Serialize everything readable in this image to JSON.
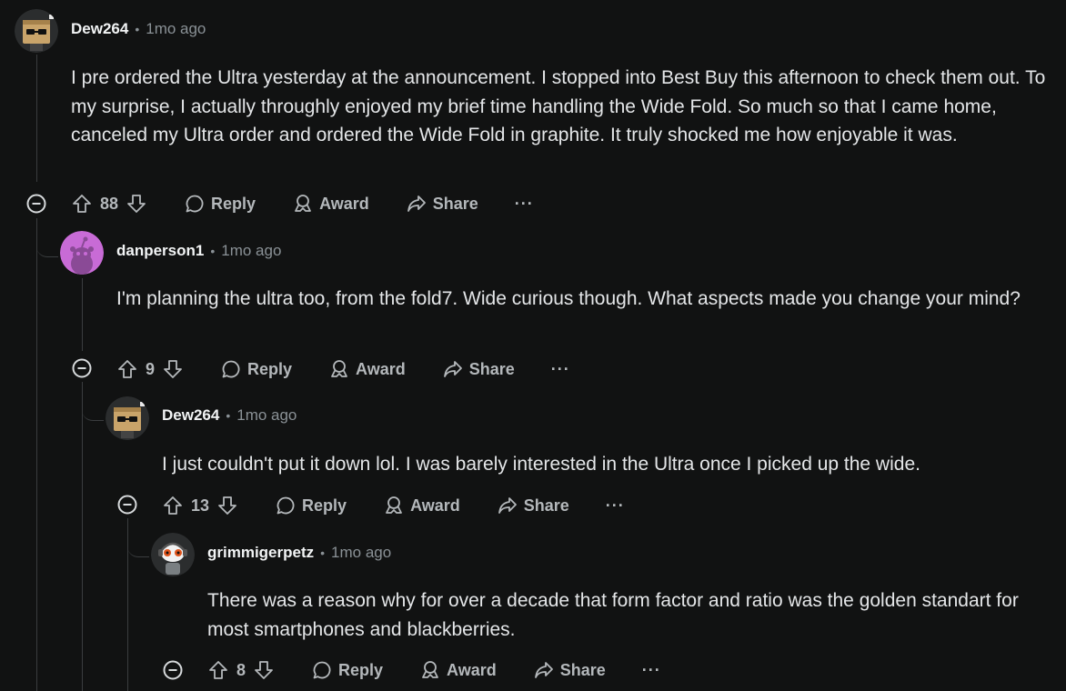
{
  "comments": [
    {
      "username": "Dew264",
      "time": "1mo ago",
      "body": "I pre ordered the Ultra yesterday at the announcement. I stopped into Best Buy this afternoon to check them out. To my surprise, I actually throughly enjoyed my brief time handling the Wide Fold. So much so that I came home, canceled my Ultra order and ordered the Wide Fold in graphite. It truly shocked me how enjoyable it was.",
      "score": "88",
      "avatar_icon": "box-character-avatar"
    },
    {
      "username": "danperson1",
      "time": "1mo ago",
      "body": "I'm planning the ultra too, from the fold7. Wide curious though. What aspects made you change your mind?",
      "score": "9",
      "avatar_icon": "snoo-avatar"
    },
    {
      "username": "Dew264",
      "time": "1mo ago",
      "body": "I just couldn't put it down lol. I was barely interested in the Ultra once I picked up the wide.",
      "score": "13",
      "avatar_icon": "box-character-avatar"
    },
    {
      "username": "grimmigerpetz",
      "time": "1mo ago",
      "body": "There was a reason why for over a decade that form factor and ratio was the golden standart for most smartphones and blackberries.",
      "score": "8",
      "avatar_icon": "snoo-headset-avatar"
    }
  ],
  "actions": {
    "reply": "Reply",
    "award": "Award",
    "share": "Share",
    "more": "···",
    "separator": "•"
  },
  "colors": {
    "background": "#111212",
    "text": "#e4e6e8",
    "muted": "#8a9196",
    "thread_line": "#3a3d3f",
    "snoo_bg": "#c86bd6"
  }
}
